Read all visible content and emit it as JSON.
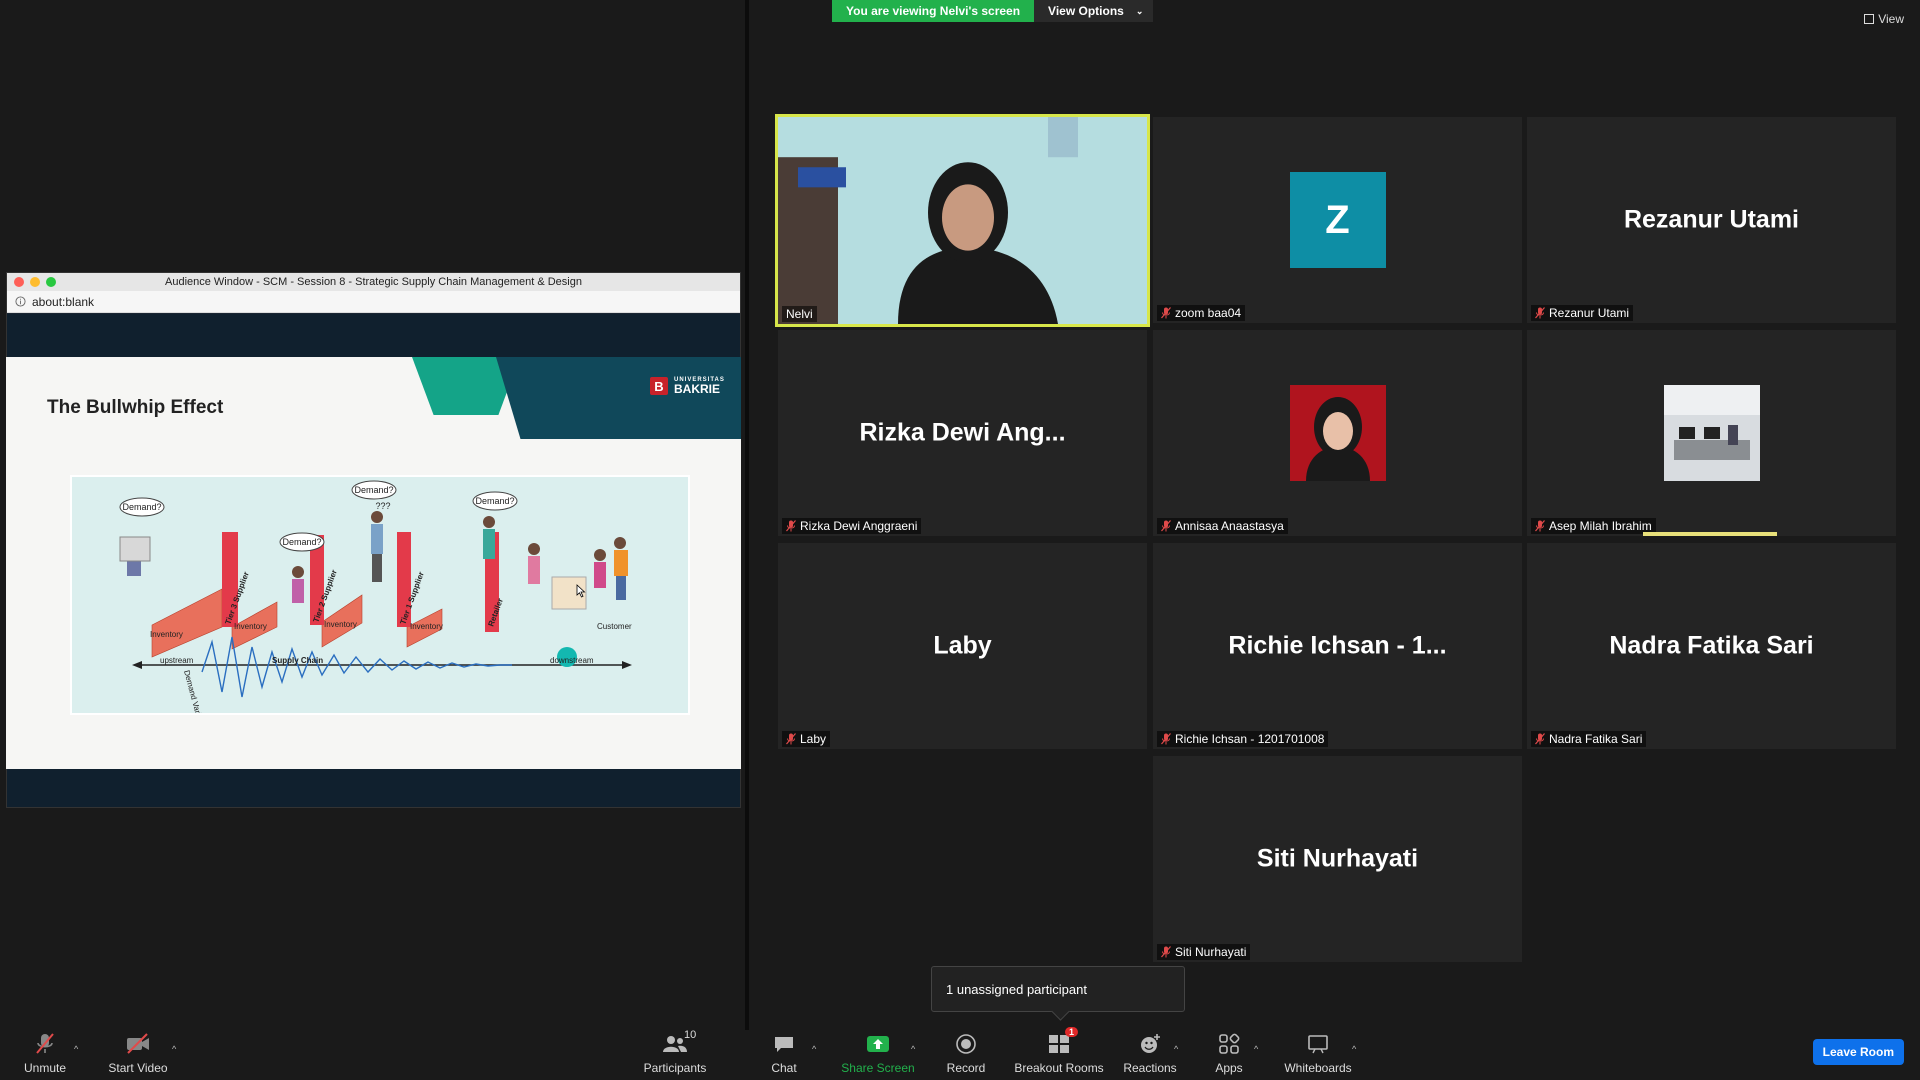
{
  "colors": {
    "accent_green": "#22b14c",
    "active_speaker_border": "#d7e64a",
    "avatar_teal": "#0e8ea5",
    "leave_blue": "#0e71eb",
    "mute_red": "#e04a4a"
  },
  "share": {
    "window_title": "Audience Window - SCM - Session 8 - Strategic Supply Chain Management & Design",
    "url": "about:blank",
    "slide": {
      "title": "The Bullwhip Effect",
      "logo_small": "UNIVERSITAS",
      "logo": "BAKRIE",
      "diagram": {
        "demand_bubbles": [
          "Demand?",
          "Demand?",
          "Demand?",
          "Demand?"
        ],
        "tier_labels": [
          "Tier 3 Supplier",
          "Tier 2 Supplier",
          "Tier 1 Supplier",
          "Retailer"
        ],
        "inventory_labels": [
          "Inventory",
          "Inventory",
          "Inventory",
          "Inventory"
        ],
        "customer": "Customer",
        "upstream": "upstream",
        "supply_chain": "Supply Chain",
        "downstream": "downstream",
        "demand_variability": "Demand Variability",
        "question": "???"
      }
    }
  },
  "banner": {
    "viewing": "You are viewing Nelvi's screen",
    "view_options": "View Options",
    "view": "View"
  },
  "participants": [
    {
      "label": "Nelvi",
      "type": "video",
      "active": true,
      "muted": false
    },
    {
      "label": "zoom baa04",
      "type": "avatar",
      "initial": "Z",
      "muted": true
    },
    {
      "label": "Rezanur Utami",
      "display": "Rezanur Utami",
      "type": "name",
      "muted": true
    },
    {
      "label": "Rizka Dewi Anggraeni",
      "display": "Rizka Dewi Ang...",
      "type": "name",
      "muted": true
    },
    {
      "label": "Annisaa Anaastasya",
      "type": "photo-person",
      "muted": true
    },
    {
      "label": "Asep Milah Ibrahim",
      "type": "photo-office",
      "muted": true
    },
    {
      "label": "Laby",
      "display": "Laby",
      "type": "name",
      "muted": true
    },
    {
      "label": "Richie Ichsan - 1201701008",
      "display": "Richie Ichsan - 1...",
      "type": "name",
      "muted": true
    },
    {
      "label": "Nadra Fatika Sari",
      "display": "Nadra Fatika Sari",
      "type": "name",
      "muted": true
    },
    {
      "label": "Siti Nurhayati",
      "display": "Siti Nurhayati",
      "type": "name",
      "muted": true
    }
  ],
  "tooltip": "1 unassigned participant",
  "toolbar": {
    "unmute": "Unmute",
    "start_video": "Start Video",
    "participants": "Participants",
    "participants_count": "10",
    "chat": "Chat",
    "share_screen": "Share Screen",
    "record": "Record",
    "breakout_rooms": "Breakout Rooms",
    "breakout_badge": "1",
    "reactions": "Reactions",
    "apps": "Apps",
    "whiteboards": "Whiteboards",
    "leave": "Leave Room"
  }
}
